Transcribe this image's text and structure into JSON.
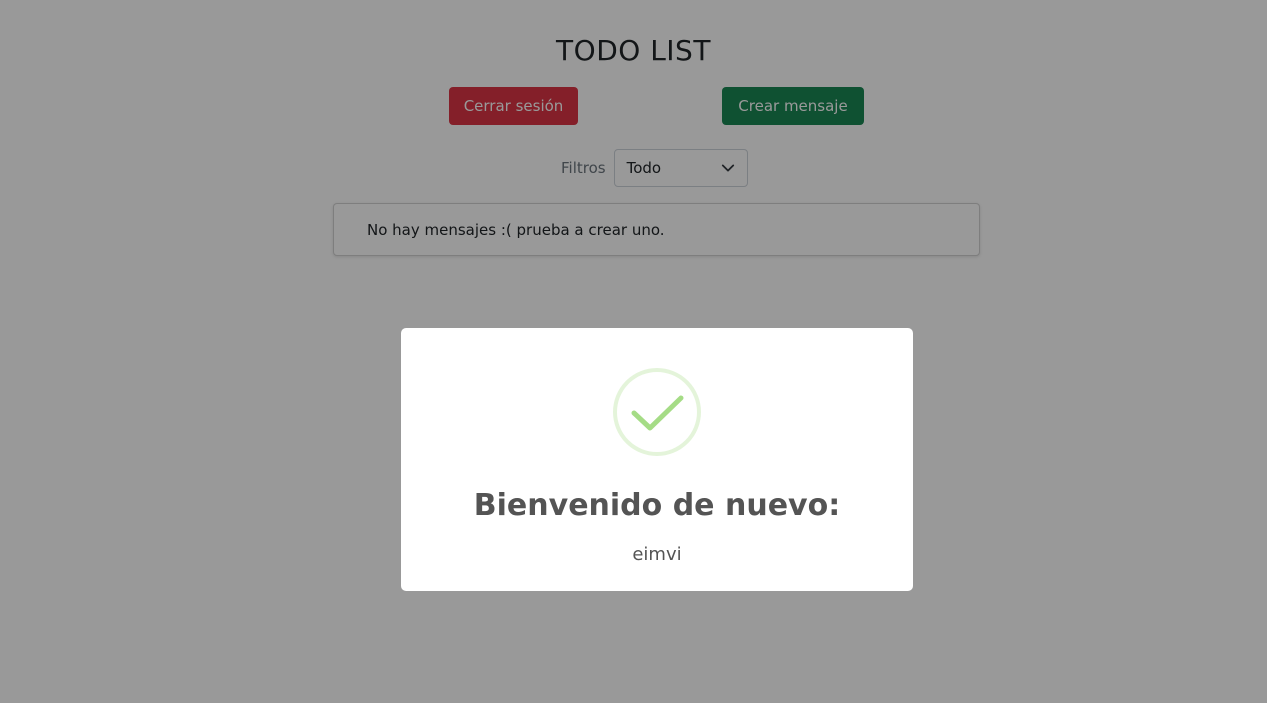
{
  "header": {
    "title": "TODO LIST"
  },
  "toolbar": {
    "logout_label": "Cerrar sesión",
    "create_label": "Crear mensaje"
  },
  "filters": {
    "label": "Filtros",
    "selected": "Todo"
  },
  "messages": {
    "empty_text": "No hay mensajes :( prueba a crear uno."
  },
  "modal": {
    "icon": "check-circle-icon",
    "title": "Bienvenido de nuevo:",
    "text": "eimvi"
  },
  "colors": {
    "danger": "#dc3545",
    "success": "#198754",
    "check": "#a5dc86"
  }
}
